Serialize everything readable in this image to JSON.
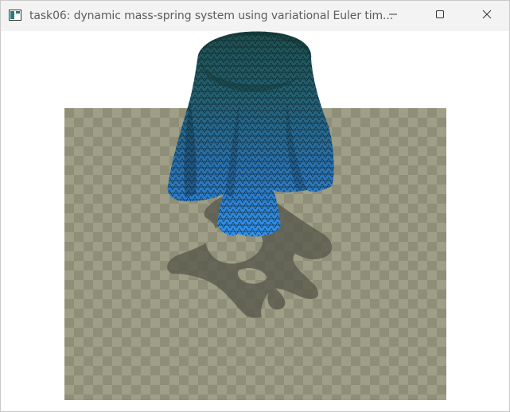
{
  "window": {
    "title": "task06: dynamic mass-spring system using variational Euler tim..."
  },
  "icons": {
    "app": "app-window-icon",
    "minimize": "minimize-icon",
    "maximize": "maximize-icon",
    "close": "close-icon"
  },
  "colors": {
    "checker_light": "#9f9e86",
    "checker_dark": "#8f8e78",
    "cloth_top": "#1f5a58",
    "cloth_bottom": "#2f8fe8",
    "shadow": "#5a5a4e"
  }
}
